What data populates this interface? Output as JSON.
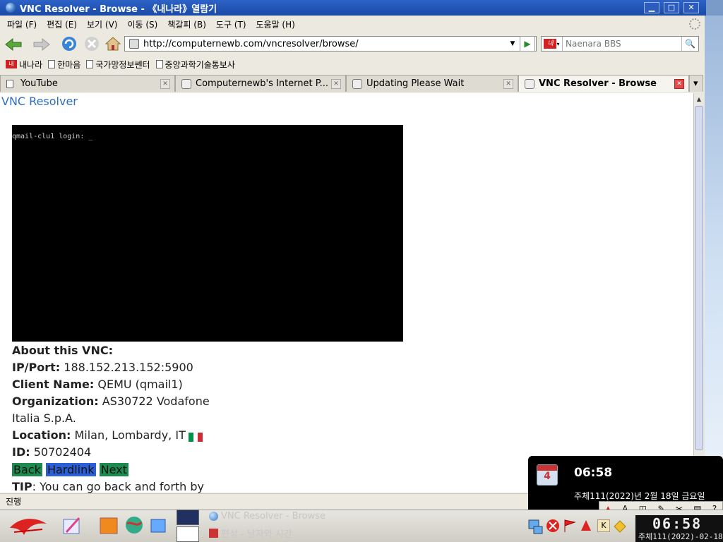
{
  "window": {
    "title": "VNC Resolver - Browse - 《내나라》열람기",
    "min": "▁",
    "max": "□",
    "close": "✕"
  },
  "menu": [
    "파일 (F)",
    "편집 (E)",
    "보기 (V)",
    "이동 (S)",
    "책갈피 (B)",
    "도구 (T)",
    "도움말 (H)"
  ],
  "toolbar": {
    "url": "http://computernewb.com/vncresolver/browse/",
    "search_placeholder": "Naenara BBS",
    "go_icon": "▶",
    "search_icon": "🔍"
  },
  "bookmarks": [
    "내나라",
    "한마음",
    "국가망정보쎈터",
    "중앙과학기술통보사"
  ],
  "tabs": [
    {
      "label": "YouTube",
      "close": "✕"
    },
    {
      "label": "Computernewb's Internet P...",
      "close": "✕"
    },
    {
      "label": "Updating Please Wait",
      "close": "✕"
    },
    {
      "label": "VNC Resolver - Browse",
      "close": "✕"
    }
  ],
  "tab_list_arrow": "▾",
  "page": {
    "title": "VNC Resolver",
    "vnc_text": "qmail-clu1 login: _",
    "about_heading": "About this VNC:",
    "ip_label": "IP/Port:",
    "ip_value": " 188.152.213.152:5900",
    "client_label": "Client Name:",
    "client_value": " QEMU (qmail1)",
    "org_label": "Organization:",
    "org_value_1": " AS30722 Vodafone",
    "org_value_2": "Italia S.p.A.",
    "location_label": "Location:",
    "location_value": " Milan, Lombardy, IT",
    "id_label": "ID:",
    "id_value": " 50702404",
    "back": "Back",
    "hardlink": "Hardlink",
    "next": "Next",
    "tip_label": "TIP",
    "tip_value": ": You can go back and forth by"
  },
  "status": "진행",
  "clock_popup": {
    "time": "06:58",
    "date": "주체111(2022)년 2월 18일 금요일"
  },
  "taskbar": {
    "task1": "VNC Resolver - Browse",
    "task2": "편성 - 날자와 시간",
    "tray_time": "06:58",
    "tray_date": "주체111(2022)-02-18"
  },
  "ime": [
    "A"
  ],
  "colors": {
    "link": "#2f6fbd",
    "back": "#1e8a4f",
    "hardlink": "#2a5fd6",
    "next": "#1e8a4f"
  }
}
